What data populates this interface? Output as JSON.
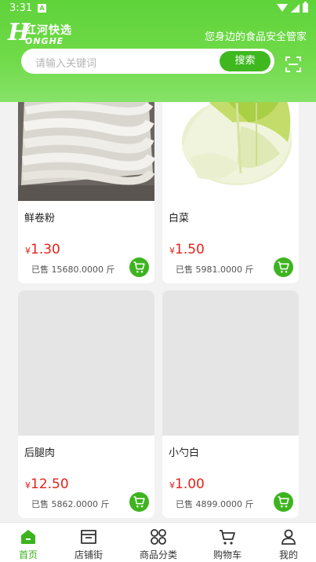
{
  "status_bar": {
    "time": "3:31",
    "notification_glyph": "A"
  },
  "header": {
    "logo_letter": "H",
    "logo_cn": "红河快选",
    "logo_en": "ONGHE",
    "slogan": "您身边的食品安全管家",
    "search_placeholder": "请输入关键词",
    "search_button": "搜索",
    "scan_icon": "scan-icon"
  },
  "products": [
    {
      "name": "鲜卷粉",
      "currency": "¥",
      "price": "1.30",
      "sold": "已售 15680.0000 斤",
      "image": "rice-noodle-photo"
    },
    {
      "name": "白菜",
      "currency": "¥",
      "price": "1.50",
      "sold": "已售 5981.0000 斤",
      "image": "cabbage-photo"
    },
    {
      "name": "后腿肉",
      "currency": "¥",
      "price": "12.50",
      "sold": "已售 5862.0000 斤",
      "image": "placeholder"
    },
    {
      "name": "小勺白",
      "currency": "¥",
      "price": "1.00",
      "sold": "已售 4899.0000 斤",
      "image": "placeholder"
    }
  ],
  "tabs": [
    {
      "label": "首页",
      "icon": "home-icon",
      "active": true
    },
    {
      "label": "店铺街",
      "icon": "store-icon",
      "active": false
    },
    {
      "label": "商品分类",
      "icon": "category-icon",
      "active": false
    },
    {
      "label": "购物车",
      "icon": "cart-icon",
      "active": false
    },
    {
      "label": "我的",
      "icon": "user-icon",
      "active": false
    }
  ],
  "colors": {
    "primary": "#3db41f",
    "header": "#5fd33a",
    "price": "#e2231a"
  }
}
